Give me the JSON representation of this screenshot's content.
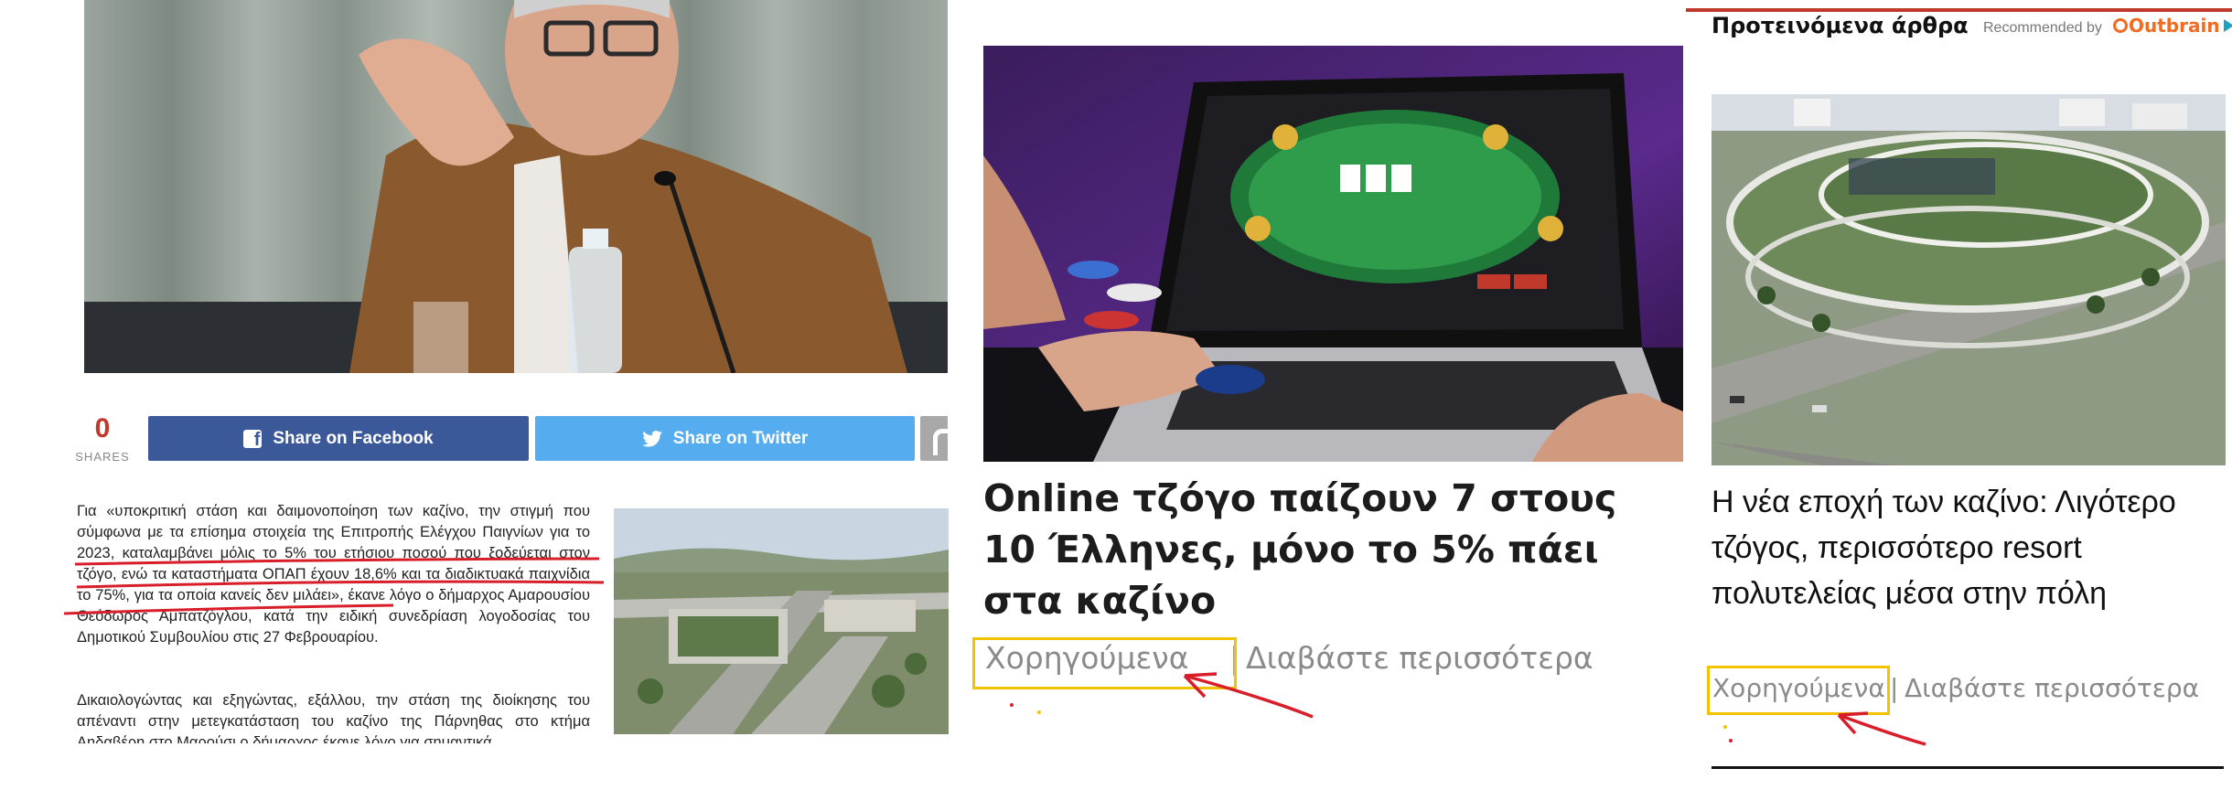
{
  "left_article": {
    "share_count": "0",
    "share_label": "SHARES",
    "facebook_button": "Share on Facebook",
    "twitter_button": "Share on Twitter",
    "paragraph_1": "Για «υποκριτική στάση και δαιμονοποίηση των καζίνο, την στιγμή που σύμφωνα με τα επίσημα στοιχεία της Επιτροπής Ελέγχου Παιγνίων για το 2023, καταλαμβάνει μόλις το 5% του ετήσιου ποσού που ξοδεύεται στον τζόγο, ενώ τα καταστήματα ΟΠΑΠ έχουν 18,6% και τα διαδικτυακά παιχνίδια το 75%, για τα οποία κανείς δεν μιλάει», έκανε λόγο ο δήμαρχος Αμαρουσίου Θεόδωρος Αμπατζόγλου, κατά την ειδική συνεδρίαση λογοδοσίας του Δημοτικού Συμβουλίου στις 27 Φεβρουαρίου.",
    "paragraph_2": "Δικαιολογώντας και εξηγώντας, εξάλλου, την στάση της διοίκησης του απέναντι στην μετεγκατάσταση του καζίνο της Πάρνηθας στο κτήμα Αηδαβέρη στο Μαρούσι ο δήμαρχος έκανε λόγο για σημαντικά"
  },
  "middle_card": {
    "headline": "Online τζόγο παίζουν 7 στους 10 Έλληνες, μόνο το 5% πάει στα καζίνο",
    "sponsored_label": "Χορηγούμενα",
    "separator": "|",
    "read_more": "Διαβάστε περισσότερα"
  },
  "right_widget": {
    "title": "Προτεινόμενα άρθρα",
    "recommended_by": "Recommended by",
    "brand": "Outbrain",
    "headline": "Η νέα εποχή των καζίνο: Λιγότερο τζόγος, περισσότερο resort πολυτελείας μέσα στην πόλη",
    "sponsored_label": "Χορηγούμενα",
    "separator": "|",
    "read_more": "Διαβάστε περισσότερα"
  },
  "colors": {
    "facebook": "#3b5998",
    "twitter": "#55acee",
    "annotation_red": "#d81e2a",
    "highlight_yellow": "#f2c300",
    "outbrain_orange": "#f26b21"
  }
}
